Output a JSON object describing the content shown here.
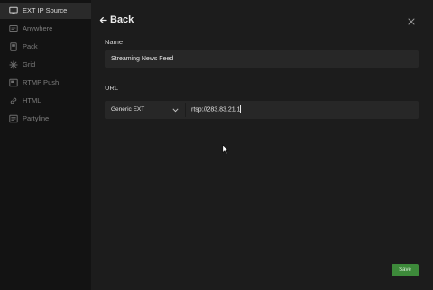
{
  "sidebar": {
    "items": [
      {
        "label": "EXT IP Source",
        "icon": "monitor-icon",
        "active": true
      },
      {
        "label": "Anywhere",
        "icon": "anywhere-icon",
        "active": false
      },
      {
        "label": "Pack",
        "icon": "pack-icon",
        "active": false
      },
      {
        "label": "Grid",
        "icon": "grid-icon",
        "active": false
      },
      {
        "label": "RTMP Push",
        "icon": "rtmp-push-icon",
        "active": false
      },
      {
        "label": "HTML",
        "icon": "link-icon",
        "active": false
      },
      {
        "label": "Partyline",
        "icon": "partyline-icon",
        "active": false
      }
    ]
  },
  "header": {
    "back_label": "Back",
    "back_icon": "arrow-left-icon",
    "close_icon": "close-icon"
  },
  "form": {
    "name_label": "Name",
    "name_value": "Streaming News Feed",
    "url_label": "URL",
    "url_type_selected": "Generic EXT",
    "url_value": "rtsp://283.83.21.1"
  },
  "actions": {
    "save_label": "Save"
  },
  "colors": {
    "background": "#1c1c1c",
    "sidebar": "#131313",
    "sidebar_active": "#2a2a2a",
    "input": "#272727",
    "save_button": "#3d8a3a"
  }
}
